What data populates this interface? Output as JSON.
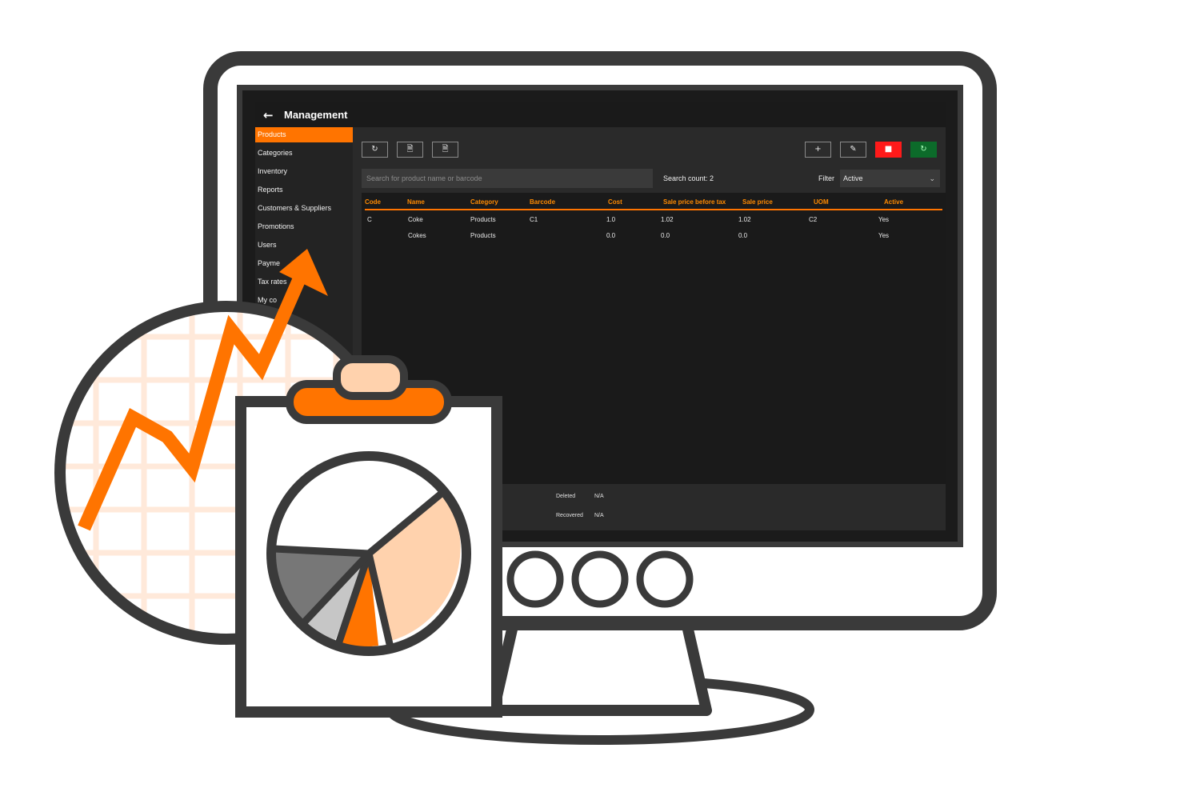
{
  "app": {
    "title": "Management",
    "back_icon": "arrow-left-icon"
  },
  "sidebar": {
    "items": [
      {
        "label": "Products",
        "active": true
      },
      {
        "label": "Categories"
      },
      {
        "label": "Inventory"
      },
      {
        "label": "Reports"
      },
      {
        "label": "Customers & Suppliers"
      },
      {
        "label": "Promotions"
      },
      {
        "label": "Users"
      },
      {
        "label": "Payme"
      },
      {
        "label": "Tax rates"
      },
      {
        "label": "My co"
      }
    ]
  },
  "toolbar": {
    "refresh_icon": "refresh-icon",
    "import_icon": "file-import-icon",
    "export_icon": "file-export-icon",
    "add_icon": "plus-icon",
    "edit_icon": "edit-icon",
    "delete_icon": "trash-icon",
    "restore_icon": "restore-icon"
  },
  "search": {
    "placeholder": "Search for product name or barcode",
    "count_text": "Search count: 2"
  },
  "filter": {
    "label": "Filter",
    "value": "Active"
  },
  "table": {
    "columns": [
      "Code",
      "Name",
      "Category",
      "Barcode",
      "Cost",
      "Sale price before tax",
      "Sale price",
      "UOM",
      "Active"
    ],
    "rows": [
      [
        "C",
        "Coke",
        "Products",
        "C1",
        "1.0",
        "1.02",
        "1.02",
        "C2",
        "Yes"
      ],
      [
        "",
        "Cokes",
        "Products",
        "",
        "0.0",
        "0.0",
        "0.0",
        "",
        "Yes"
      ]
    ]
  },
  "footer": {
    "deleted_label": "Deleted",
    "deleted_value": "N/A",
    "recovered_label": "Recovered",
    "recovered_value": "N/A"
  },
  "colors": {
    "accent": "#ff7400",
    "outline": "#3a3a3a",
    "peach": "#ffd2ad",
    "danger": "#ff1a1a",
    "success": "#0c6b2a"
  }
}
